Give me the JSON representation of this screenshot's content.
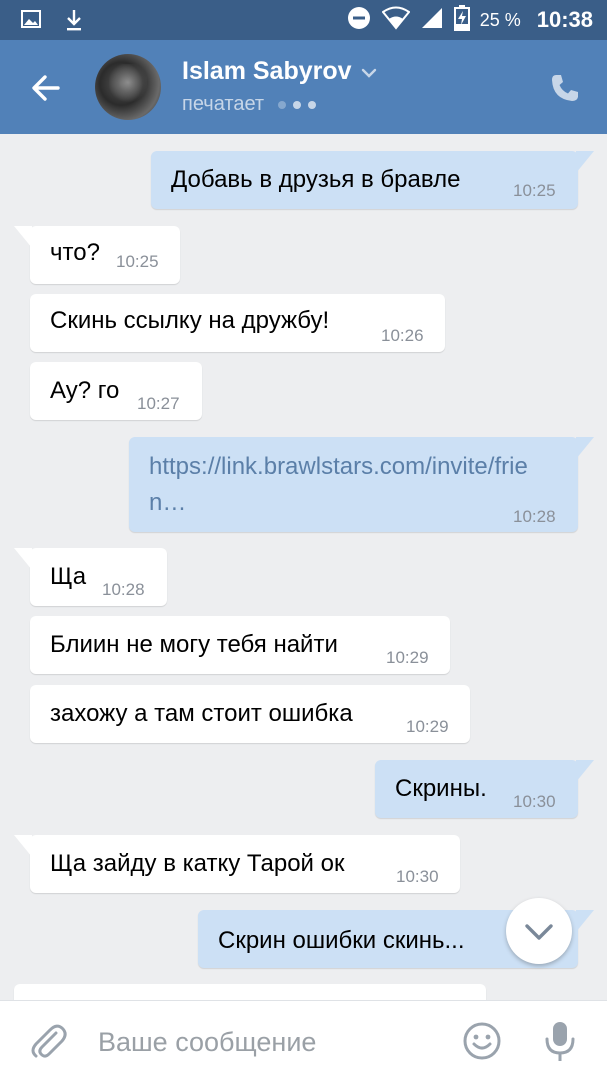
{
  "status_bar": {
    "battery_percent": "25 %",
    "time": "10:38",
    "icons": [
      "gallery-icon",
      "download-icon",
      "dnd-icon",
      "wifi-icon",
      "signal-icon",
      "battery-icon"
    ]
  },
  "header": {
    "name": "Islam Sabyrov",
    "status": "печатает"
  },
  "messages": [
    {
      "dir": "out",
      "text": "Добавь в друзья в бравле",
      "time": "10:25"
    },
    {
      "dir": "in",
      "text": "что?",
      "time": "10:25"
    },
    {
      "dir": "in",
      "text": "Скинь ссылку на дружбу!",
      "time": "10:26"
    },
    {
      "dir": "in",
      "text": "Ау? го",
      "time": "10:27"
    },
    {
      "dir": "out",
      "text": "https://link.brawlstars.com/invite/frien…",
      "time": "10:28",
      "is_link": true
    },
    {
      "dir": "in",
      "text": "Ща",
      "time": "10:28"
    },
    {
      "dir": "in",
      "text": "Блиин не могу тебя найти",
      "time": "10:29"
    },
    {
      "dir": "in",
      "text": "захожу а там стоит ошибка",
      "time": "10:29"
    },
    {
      "dir": "out",
      "text": "Скрины.",
      "time": "10:30"
    },
    {
      "dir": "in",
      "text": "Ща зайду в катку Тарой ок",
      "time": "10:30"
    },
    {
      "dir": "out",
      "text": "Скрин ошибки скинь...",
      "time": ""
    }
  ],
  "composer": {
    "placeholder": "Ваше сообщение"
  },
  "colors": {
    "status_bar": "#3a5e88",
    "header": "#5181b8",
    "chat_bg": "#edeef0",
    "incoming": "#ffffff",
    "outgoing": "#cce0f5",
    "link": "#5b7fa8",
    "icon_gray": "#9aa3ad"
  }
}
